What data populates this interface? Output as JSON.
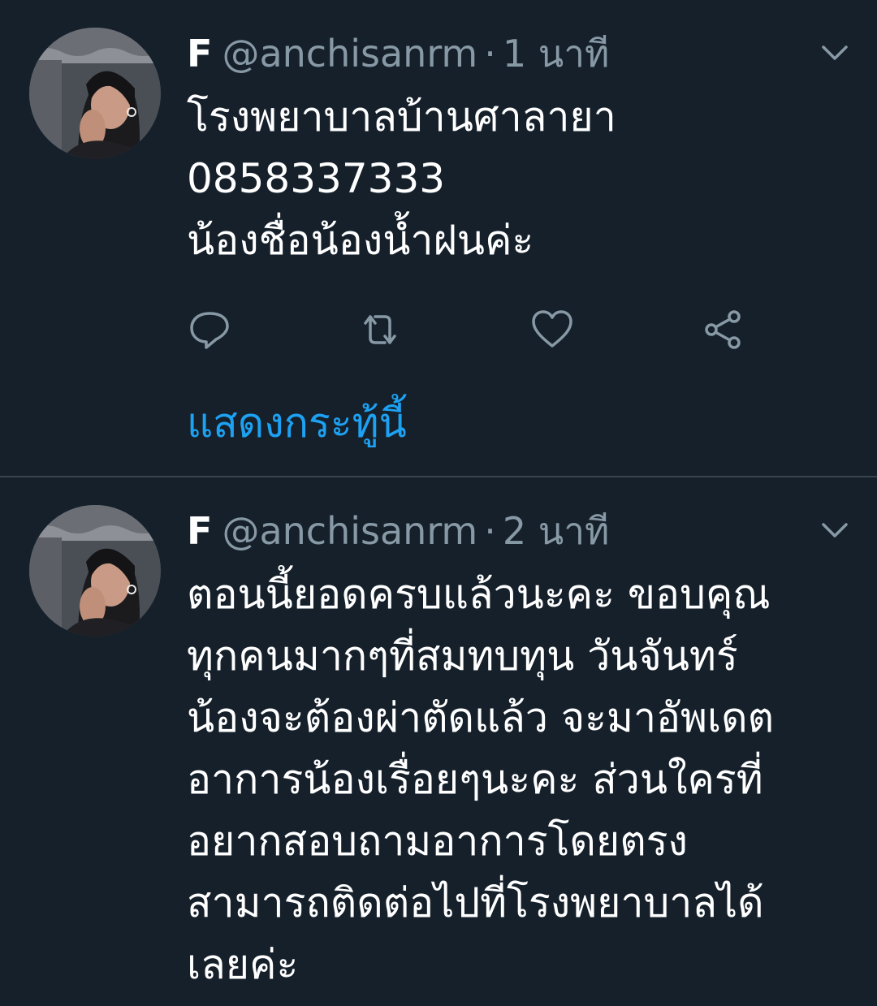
{
  "tweets": [
    {
      "display_name": "F",
      "handle": "@anchisanrm",
      "separator": "·",
      "time": "1 นาที",
      "lines": [
        "โรงพยาบาลบ้านศาลายา",
        "0858337333",
        "น้องชื่อน้องน้ำฝนค่ะ"
      ],
      "show_thread": "แสดงกระทู้นี้"
    },
    {
      "display_name": "F",
      "handle": "@anchisanrm",
      "separator": "·",
      "time": "2 นาที",
      "lines": [
        "ตอนนี้ยอดครบแล้วนะคะ ขอบคุณ",
        "ทุกคนมากๆที่สมทบทุน วันจันทร์",
        "น้องจะต้องผ่าตัดแล้ว จะมาอัพเดต",
        "อาการน้องเรื่อยๆนะคะ ส่วนใครที่",
        "อยากสอบถามอาการโดยตรง",
        "สามารถติดต่อไปที่โรงพยาบาลได้",
        "เลยค่ะ"
      ]
    }
  ],
  "icons": [
    "reply-icon",
    "retweet-icon",
    "like-icon",
    "share-icon",
    "chevron-down-icon"
  ],
  "colors": {
    "background": "#15202b",
    "text": "#ffffff",
    "muted": "#8899a6",
    "accent": "#1da1f2",
    "divider": "#38444d"
  }
}
